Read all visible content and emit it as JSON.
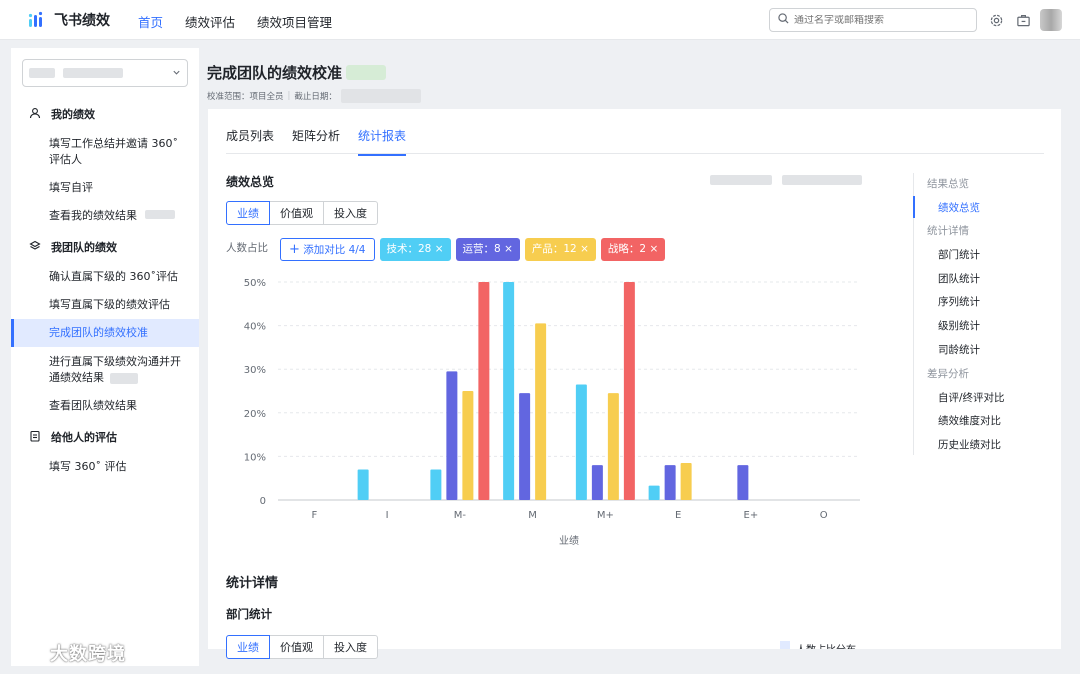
{
  "app": {
    "name": "飞书绩效"
  },
  "nav": {
    "items": [
      "首页",
      "绩效评估",
      "绩效项目管理"
    ],
    "active_index": 0
  },
  "search": {
    "placeholder": "通过名字或邮箱搜索"
  },
  "sidebar": {
    "sections": [
      {
        "title": "我的绩效",
        "icon": "user-icon",
        "items": [
          "填写工作总结并邀请 360˚ 评估人",
          "填写自评",
          "查看我的绩效结果"
        ]
      },
      {
        "title": "我团队的绩效",
        "icon": "layers-icon",
        "items": [
          "确认直属下级的 360˚评估",
          "填写直属下级的绩效评估",
          "完成团队的绩效校准",
          "进行直属下级绩效沟通并开通绩效结果",
          "查看团队绩效结果"
        ]
      },
      {
        "title": "给他人的评估",
        "icon": "form-icon",
        "items": [
          "填写 360˚ 评估"
        ]
      }
    ],
    "active_item": "完成团队的绩效校准"
  },
  "page": {
    "title": "完成团队的绩效校准",
    "meta_scope": "校准范围：项目全员",
    "meta_sep": "|",
    "meta_deadline": "截止日期："
  },
  "tabs": {
    "items": [
      "成员列表",
      "矩阵分析",
      "统计报表"
    ],
    "active_index": 2
  },
  "overview": {
    "title": "绩效总览",
    "segments": [
      "业绩",
      "价值观",
      "投入度"
    ],
    "active_segment": 0,
    "y_label": "人数占比",
    "add_compare": "添加对比 4/4"
  },
  "tags": [
    {
      "label": "技术：28",
      "color": "#50cef5"
    },
    {
      "label": "运营：8",
      "color": "#6266e0"
    },
    {
      "label": "产品：12",
      "color": "#f7cd4f"
    },
    {
      "label": "战略：2",
      "color": "#f26464"
    }
  ],
  "chart_data": {
    "type": "bar",
    "xlabel": "业绩",
    "ylabel": "人数占比",
    "categories": [
      "F",
      "I",
      "M-",
      "M",
      "M+",
      "E",
      "E+",
      "O"
    ],
    "ylim": [
      0,
      50
    ],
    "yticks": [
      "0",
      "10%",
      "20%",
      "30%",
      "40%",
      "50%"
    ],
    "series": [
      {
        "name": "技术",
        "color": "#50cef5",
        "values": [
          0,
          7,
          7,
          50,
          26.5,
          3.3,
          0,
          0
        ]
      },
      {
        "name": "运营",
        "color": "#6266e0",
        "values": [
          0,
          0,
          29.5,
          24.5,
          8,
          8,
          8,
          0
        ]
      },
      {
        "name": "产品",
        "color": "#f7cd4f",
        "values": [
          0,
          0,
          25,
          40.5,
          24.5,
          8.5,
          0,
          0
        ]
      },
      {
        "name": "战略",
        "color": "#f26464",
        "values": [
          0,
          0,
          50,
          0,
          50,
          0,
          0,
          0
        ]
      }
    ],
    "grid": true
  },
  "right_nav": [
    {
      "label": "结果总览",
      "type": "group"
    },
    {
      "label": "绩效总览",
      "type": "link",
      "active": true
    },
    {
      "label": "统计详情",
      "type": "group"
    },
    {
      "label": "部门统计",
      "type": "link"
    },
    {
      "label": "团队统计",
      "type": "link"
    },
    {
      "label": "序列统计",
      "type": "link"
    },
    {
      "label": "级别统计",
      "type": "link"
    },
    {
      "label": "司龄统计",
      "type": "link"
    },
    {
      "label": "差异分析",
      "type": "group"
    },
    {
      "label": "自评/终评对比",
      "type": "link"
    },
    {
      "label": "绩效维度对比",
      "type": "link"
    },
    {
      "label": "历史业绩对比",
      "type": "link"
    }
  ],
  "details": {
    "title": "统计详情",
    "dept_title": "部门统计",
    "segments": [
      "业绩",
      "价值观",
      "投入度"
    ],
    "legend_partial": "人数占比分布"
  },
  "watermark": {
    "text": "大数跨境"
  }
}
